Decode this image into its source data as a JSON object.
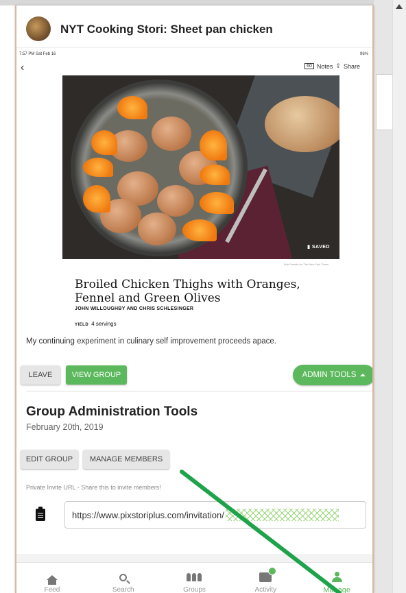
{
  "app": {
    "title": "NYT Cooking Stori: Sheet pan chicken"
  },
  "ipad": {
    "status_time": "7:57 PM  Sat Feb 16",
    "status_right": "96%",
    "notes_count": "60",
    "notes_label": "Notes",
    "share_label": "Share",
    "saved_badge": "SAVED",
    "photo_credit": "Bob Fasotto for The New York Times",
    "recipe_title": "Broiled Chicken Thighs with Oranges, Fennel and Green Olives",
    "authors": "JOHN WILLOUGHBY AND CHRIS SCHLESINGER",
    "yield_label": "YIELD",
    "yield_value": "4 servings"
  },
  "post": {
    "description": "My continuing experiment in culinary self improvement proceeds apace."
  },
  "actions": {
    "leave": "LEAVE",
    "view_group": "VIEW GROUP",
    "admin_tools": "ADMIN TOOLS"
  },
  "admin": {
    "title": "Group Administration Tools",
    "date": "February 20th, 2019",
    "edit_group": "EDIT GROUP",
    "manage_members": "MANAGE MEMBERS",
    "invite_label": "Private Invite URL - Share this to invite members!",
    "invite_url": "https://www.pixstoriplus.com/invitation/"
  },
  "nav": {
    "items": [
      {
        "label": "Feed",
        "icon": "home-icon"
      },
      {
        "label": "Search",
        "icon": "search-icon"
      },
      {
        "label": "Groups",
        "icon": "groups-icon"
      },
      {
        "label": "Activity",
        "icon": "activity-icon"
      },
      {
        "label": "Manage",
        "icon": "person-icon"
      }
    ],
    "active": "Manage"
  },
  "colors": {
    "accent_green": "#5cb85c",
    "arrow_green": "#1ea34a"
  }
}
